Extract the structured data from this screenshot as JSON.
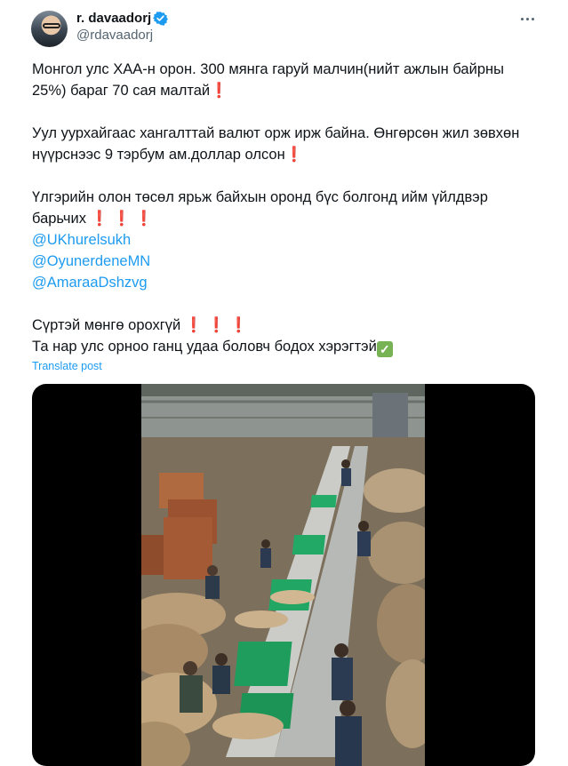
{
  "author": {
    "name": "r. davaadorj",
    "handle": "@rdavaadorj"
  },
  "icons": {
    "verified": "verified-badge-icon",
    "more": "more-options-icon",
    "exclamation": "red-exclamation-emoji",
    "check": "white-check-mark-emoji"
  },
  "post": {
    "lines": {
      "l1": "Монгол улс ХАА-н орон. 300 мянга гаруй малчин(нийт ажлын байрны",
      "l2": "25%) бараг 70 сая малтай",
      "l3": "Уул уурхайгаас хангалттай валют орж ирж байна. Өнгөрсөн жил зөвхөн",
      "l4": "нүүрснээс 9 тэрбум ам.доллар олсон",
      "l5": "Үлгэрийн олон төсөл ярьж байхын оронд бүс болгонд ийм үйлдвэр",
      "l6": "барьчих",
      "l7": "Сүртэй мөнгө орохгүй",
      "l8": "Та нар улс орноо ганц удаа боловч бодох хэрэгтэй"
    },
    "mentions": [
      "@UKhurelsukh",
      "@OyunerdeneMN",
      "@AmaraaDshzvg"
    ],
    "emoji": {
      "exclamation": "❗",
      "check": "✓"
    },
    "translate_label": "Translate post"
  },
  "colors": {
    "link": "#1d9bf0",
    "secondary_text": "#536471",
    "verified": "#1d9bf0",
    "media_bg": "#000000"
  }
}
